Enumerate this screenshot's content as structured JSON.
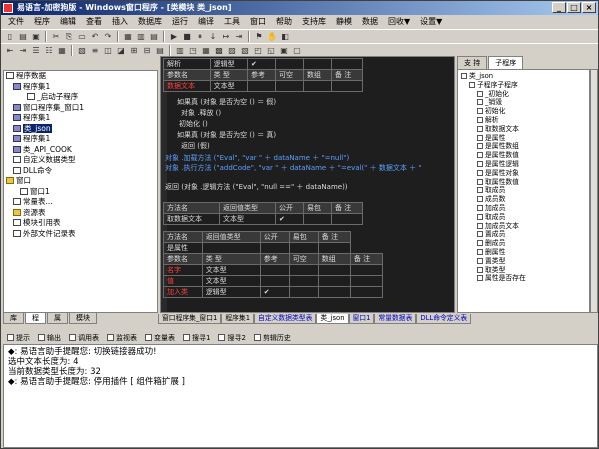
{
  "window": {
    "title": "易语言-加密狗版 - Windows窗口程序 - [类模块 类_json]"
  },
  "menu": [
    "文件",
    "程序",
    "编辑",
    "查看",
    "插入",
    "数据库",
    "运行",
    "编译",
    "工具",
    "窗口",
    "帮助",
    "支持库",
    "静模",
    "数据",
    "回收▼",
    "设置▼"
  ],
  "project": {
    "items": [
      {
        "label": "程序数据",
        "indent": 0,
        "icon": "page"
      },
      {
        "label": "程序集1",
        "indent": 1,
        "icon": "cls"
      },
      {
        "label": "_启动子程序",
        "indent": 3,
        "icon": "page"
      },
      {
        "label": "窗口程序集_窗口1",
        "indent": 1,
        "icon": "cls"
      },
      {
        "label": "程序集1",
        "indent": 1,
        "icon": "cls"
      },
      {
        "label": "类_json",
        "indent": 1,
        "icon": "cls",
        "selected": true
      },
      {
        "label": "程序集1",
        "indent": 1,
        "icon": "cls"
      },
      {
        "label": "类_API_COOK",
        "indent": 1,
        "icon": "cls"
      },
      {
        "label": "自定义数据类型",
        "indent": 1,
        "icon": "page"
      },
      {
        "label": "DLL命令",
        "indent": 1,
        "icon": "page"
      },
      {
        "label": "窗口",
        "indent": 0,
        "icon": "fold"
      },
      {
        "label": "窗口1",
        "indent": 2,
        "icon": "page"
      },
      {
        "label": "常量表...",
        "indent": 1,
        "icon": "page"
      },
      {
        "label": "资源表",
        "indent": 1,
        "icon": "fold"
      },
      {
        "label": "模块引用表",
        "indent": 1,
        "icon": "page"
      },
      {
        "label": "外部文件记录表",
        "indent": 1,
        "icon": "page"
      }
    ]
  },
  "left_tabs": [
    "库",
    "程",
    "属",
    "模块"
  ],
  "editor": {
    "t1_rows": [
      [
        "解析",
        "逻辑型",
        "✔",
        "",
        "",
        ""
      ],
      [
        "参数名",
        "类 型",
        "参考",
        "可空",
        "数组",
        "备 注"
      ],
      [
        "数据文本",
        "文本型",
        "",
        "",
        "",
        ""
      ]
    ],
    "code_lines": [
      {
        "t": "如果真 (对象 是否为空 () ＝ 假)",
        "cls": ""
      },
      {
        "t": "对象 .释放 ()",
        "cls": ""
      },
      {
        "t": "初始化 ()",
        "cls": ""
      },
      {
        "t": "如果真 (对象 是否为空 () ＝ 真)",
        "cls": ""
      },
      {
        "t": "返回 (假)",
        "cls": ""
      },
      {
        "t": "对象 .加载方法 (\"Eval\", \"var \" ＋ dataName ＋ \"=null\")",
        "cls": "kw"
      },
      {
        "t": "对象 .执行方法 (\"addCode\", \"var \" ＋ dataName ＋ \"=eval(\" ＋ 数据文本 ＋ \"",
        "cls": "kw"
      },
      {
        "t": "返回 (对象 .逻辑方法 (\"Eval\", \"null ==\" ＋ dataName))",
        "cls": ""
      }
    ],
    "t2_rows": [
      [
        "方法名",
        "返回值类型",
        "公开",
        "易包",
        "备 注"
      ],
      [
        "取数据文本",
        "文本型",
        "✔",
        "",
        ""
      ]
    ],
    "t3_rows": [
      [
        "方法名",
        "返回值类型",
        "公开",
        "易包",
        "备 注"
      ],
      [
        "是属性",
        "",
        "",
        "",
        ""
      ],
      [
        "参数名",
        "类 型",
        "参考",
        "可空",
        "数组",
        "备 注"
      ],
      [
        "名字",
        "文本型",
        "",
        "",
        "",
        ""
      ],
      [
        "值",
        "文本型",
        "",
        "",
        "",
        ""
      ],
      [
        "加入类",
        "逻辑型",
        "✔",
        "",
        "",
        ""
      ]
    ]
  },
  "right_panel": {
    "tabs": [
      "支 持",
      "子程序"
    ],
    "items": [
      {
        "label": "类_json",
        "indent": 0
      },
      {
        "label": "子程序子程序",
        "indent": 1
      },
      {
        "label": "_初始化",
        "indent": 2
      },
      {
        "label": "_销毁",
        "indent": 2
      },
      {
        "label": "初始化",
        "indent": 2
      },
      {
        "label": "解析",
        "indent": 2
      },
      {
        "label": "取数据文本",
        "indent": 2
      },
      {
        "label": "是属性",
        "indent": 2
      },
      {
        "label": "是属性数组",
        "indent": 2
      },
      {
        "label": "是属性数值",
        "indent": 2
      },
      {
        "label": "是属性逻辑",
        "indent": 2
      },
      {
        "label": "是属性对象",
        "indent": 2
      },
      {
        "label": "取属性数值",
        "indent": 2
      },
      {
        "label": "取成员",
        "indent": 2
      },
      {
        "label": "成员数",
        "indent": 2
      },
      {
        "label": "加成员",
        "indent": 2
      },
      {
        "label": "取成员",
        "indent": 2
      },
      {
        "label": "加成员文本",
        "indent": 2
      },
      {
        "label": "置成员",
        "indent": 2
      },
      {
        "label": "删成员",
        "indent": 2
      },
      {
        "label": "删属性",
        "indent": 2
      },
      {
        "label": "置类型",
        "indent": 2
      },
      {
        "label": "取类型",
        "indent": 2
      },
      {
        "label": "属性是否存在",
        "indent": 2
      }
    ]
  },
  "doc_tabs": [
    {
      "label": "窗口程序集_窗口1",
      "active": false,
      "blue": false
    },
    {
      "label": "程序集1",
      "active": false,
      "blue": false
    },
    {
      "label": "自定义数据类型表",
      "active": false,
      "blue": true
    },
    {
      "label": "类_json",
      "active": true,
      "blue": false
    },
    {
      "label": "窗口1",
      "active": false,
      "blue": true
    },
    {
      "label": "常量数据表",
      "active": false,
      "blue": true
    },
    {
      "label": "DLL命令定义表",
      "active": false,
      "blue": true
    }
  ],
  "output_tabs": [
    "提示",
    "输出",
    "调用表",
    "监视表",
    "变量表",
    "搜寻1",
    "搜寻2",
    "剪辑历史"
  ],
  "output_lines": [
    "◆: 易语言助手提醒您: 切换链接器成功!",
    "选中文本长度为: 4",
    "当前数据类型长度为: 32",
    "◆: 易语言助手提醒您: 停用插件 [ 组件箱扩展 ]"
  ]
}
